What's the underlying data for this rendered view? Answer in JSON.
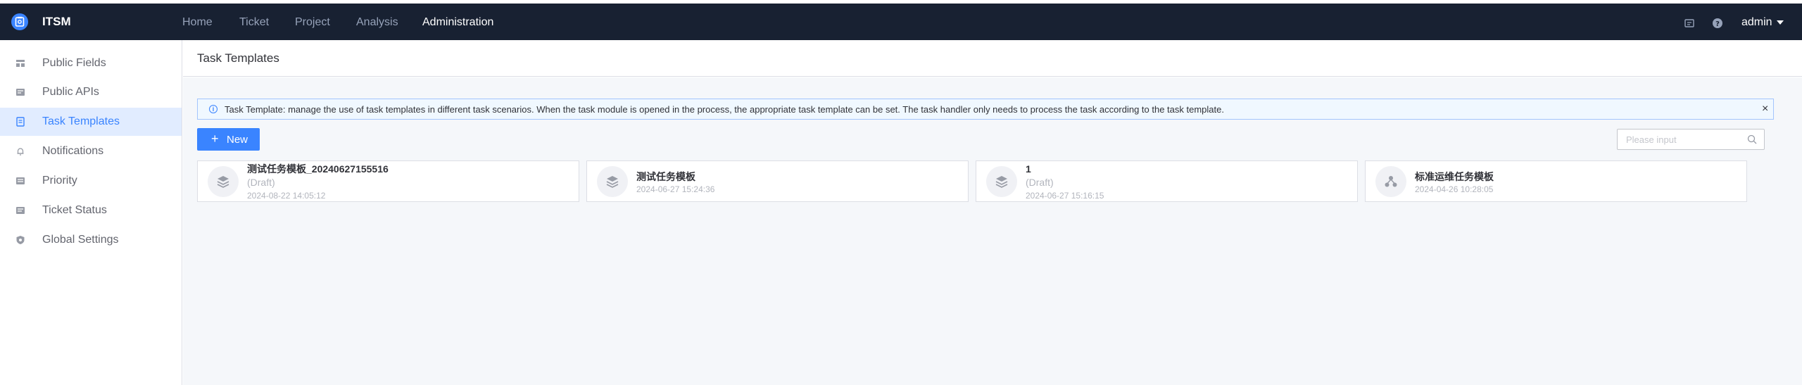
{
  "app": {
    "name": "ITSM"
  },
  "nav": {
    "items": [
      {
        "label": "Home",
        "active": false
      },
      {
        "label": "Ticket",
        "active": false
      },
      {
        "label": "Project",
        "active": false
      },
      {
        "label": "Analysis",
        "active": false
      },
      {
        "label": "Administration",
        "active": true
      }
    ],
    "icons": [
      "message-icon",
      "help-icon"
    ],
    "user": "admin"
  },
  "sidebar": {
    "items": [
      {
        "label": "Public Fields",
        "icon": "fields-icon",
        "active": false
      },
      {
        "label": "Public APIs",
        "icon": "api-icon",
        "active": false
      },
      {
        "label": "Task Templates",
        "icon": "template-icon",
        "active": true
      },
      {
        "label": "Notifications",
        "icon": "bell-icon",
        "active": false
      },
      {
        "label": "Priority",
        "icon": "priority-icon",
        "active": false
      },
      {
        "label": "Ticket Status",
        "icon": "status-icon",
        "active": false
      },
      {
        "label": "Global Settings",
        "icon": "settings-icon",
        "active": false
      }
    ]
  },
  "page": {
    "title": "Task Templates",
    "alert": {
      "icon": "info-icon",
      "text": "Task Template: manage the use of task templates in different task scenarios. When the task module is opened in the process, the appropriate task template can be set. The task handler only needs to process the task according to the task template.",
      "close": "×"
    },
    "new_button": {
      "plus": "+",
      "label": "New"
    },
    "search": {
      "placeholder": "Please input",
      "value": ""
    }
  },
  "templates": [
    {
      "title": "测试任务模板_20240627155516",
      "status": "(Draft)",
      "time": "2024-08-22 14:05:12",
      "icon": "stack-icon"
    },
    {
      "title": "测试任务模板",
      "status": "",
      "time": "2024-06-27 15:24:36",
      "icon": "stack-icon"
    },
    {
      "title": "1",
      "status": "(Draft)",
      "time": "2024-06-27 15:16:15",
      "icon": "stack-icon"
    },
    {
      "title": "标准运维任务模板",
      "status": "",
      "time": "2024-04-26 10:28:05",
      "icon": "nodes-icon"
    }
  ],
  "colors": {
    "topbar": "#182132",
    "accent": "#3a84ff",
    "nav_inactive": "#96a2b9",
    "sidebar_active_bg": "#e1ecff",
    "content_bg": "#f5f7fa",
    "muted_text": "#b2b5bd"
  }
}
